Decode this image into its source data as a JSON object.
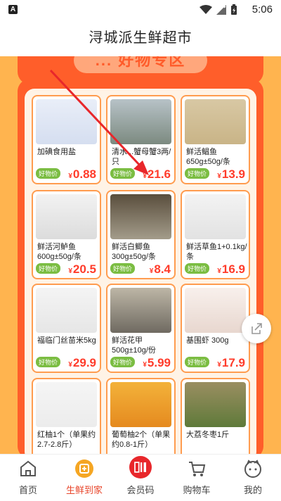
{
  "status": {
    "time": "5:06",
    "app_badge": "A"
  },
  "header": {
    "title": "浔城派生鲜超市"
  },
  "banner": {
    "title": "... 好物专区"
  },
  "products": [
    {
      "name": "加碘食用盐",
      "tag": "好物价",
      "currency": "¥",
      "price": "0.88"
    },
    {
      "name": "清水...蟹母蟹3两/只",
      "tag": "好物价",
      "currency": "¥",
      "price": "21.6"
    },
    {
      "name": "鲜活鲳鱼650g±50g/条",
      "tag": "好物价",
      "currency": "¥",
      "price": "13.9"
    },
    {
      "name": "鲜活河鲈鱼600g±50g/条",
      "tag": "好物价",
      "currency": "¥",
      "price": "20.5"
    },
    {
      "name": "鲜活白鲫鱼300g±50g/条",
      "tag": "好物价",
      "currency": "¥",
      "price": "8.4"
    },
    {
      "name": "鲜活草鱼1+0.1kg/条",
      "tag": "好物价",
      "currency": "¥",
      "price": "16.9"
    },
    {
      "name": "福临门丝苗米5kg",
      "tag": "好物价",
      "currency": "¥",
      "price": "29.9"
    },
    {
      "name": "鲜活花甲500g±10g/份",
      "tag": "好物价",
      "currency": "¥",
      "price": "5.99"
    },
    {
      "name": "基围虾 300g",
      "tag": "好物价",
      "currency": "¥",
      "price": "17.9"
    },
    {
      "name": "红柚1个（单果约2.7-2.8斤）",
      "tag": "",
      "currency": "",
      "price": ""
    },
    {
      "name": "葡萄柚2个（单果约0.8-1斤）",
      "tag": "",
      "currency": "",
      "price": ""
    },
    {
      "name": "大荔冬枣1斤",
      "tag": "",
      "currency": "",
      "price": ""
    }
  ],
  "nav": [
    {
      "label": "首页",
      "icon": "home-icon"
    },
    {
      "label": "生鲜到家",
      "icon": "fresh-delivery-icon"
    },
    {
      "label": "会员码",
      "icon": "member-code-icon"
    },
    {
      "label": "购物车",
      "icon": "cart-icon"
    },
    {
      "label": "我的",
      "icon": "profile-icon"
    }
  ],
  "colors": {
    "accent": "#ff5e2a",
    "price": "#ff3b2a",
    "tag": "#7bbd42",
    "background": "#ffb44f",
    "nav_active": "#e8462b"
  }
}
